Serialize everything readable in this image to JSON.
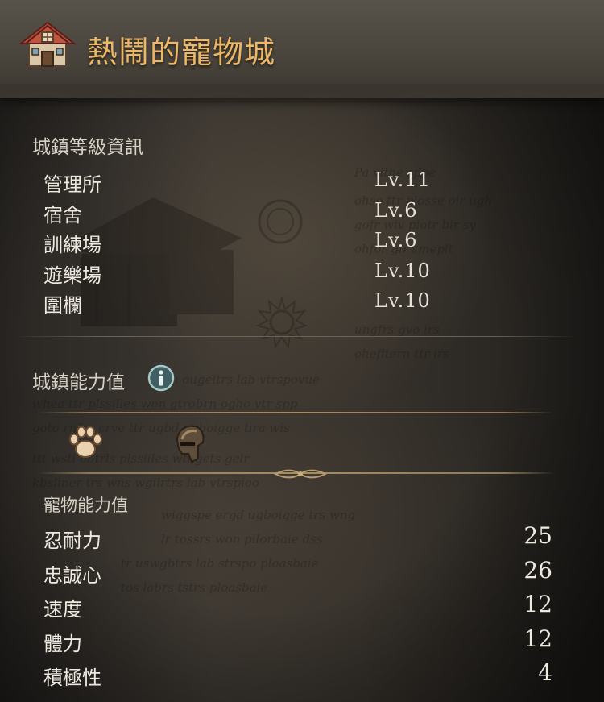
{
  "header": {
    "title": "熱鬧的寵物城",
    "icon": "house-icon"
  },
  "town_level": {
    "title": "城鎮等級資訊",
    "rows": [
      {
        "label": "管理所",
        "level": "Lv.11"
      },
      {
        "label": "宿舍",
        "level": "Lv.6"
      },
      {
        "label": "訓練場",
        "level": "Lv.6"
      },
      {
        "label": "遊樂場",
        "level": "Lv.10"
      },
      {
        "label": "圍欄",
        "level": "Lv.10"
      }
    ]
  },
  "town_ability": {
    "title": "城鎮能力值",
    "info_icon": "info-icon",
    "tabs": [
      {
        "icon": "paw-icon",
        "selected": true
      },
      {
        "icon": "helmet-icon",
        "selected": false
      }
    ]
  },
  "pet_ability": {
    "title": "寵物能力值",
    "stats": [
      {
        "label": "忍耐力",
        "value": "25"
      },
      {
        "label": "忠誠心",
        "value": "26"
      },
      {
        "label": "速度",
        "value": "12"
      },
      {
        "label": "體力",
        "value": "12"
      },
      {
        "label": "積極性",
        "value": "4"
      }
    ]
  },
  "colors": {
    "title_gold": "#ecb766",
    "text_light": "#efeae0",
    "panel_dark": "#242220"
  }
}
